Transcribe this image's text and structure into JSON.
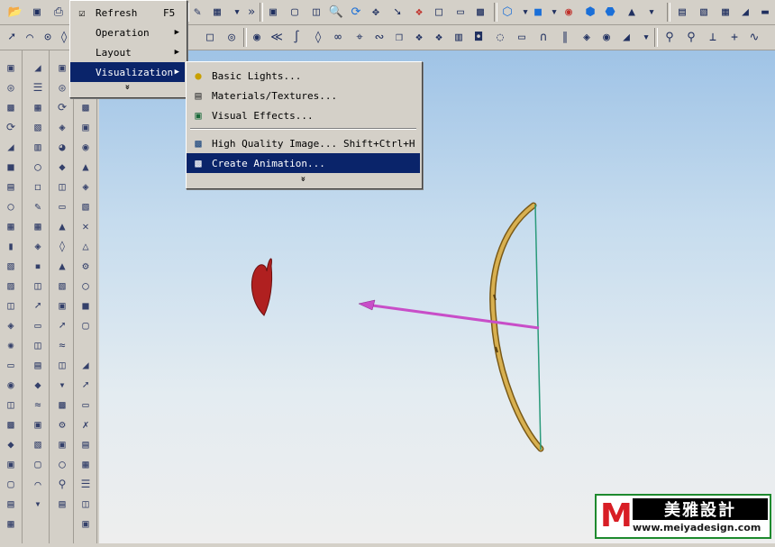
{
  "menus": {
    "main": {
      "items": [
        {
          "label": "Refresh",
          "accel": "F5"
        },
        {
          "label": "Operation"
        },
        {
          "label": "Layout"
        },
        {
          "label": "Visualization"
        }
      ]
    },
    "visualization": {
      "items": [
        {
          "label": "Basic Lights..."
        },
        {
          "label": "Materials/Textures..."
        },
        {
          "label": "Visual Effects..."
        },
        {
          "label": "High Quality Image...",
          "accel": "Shift+Ctrl+H"
        },
        {
          "label": "Create Animation..."
        }
      ]
    },
    "more_glyph": "»"
  },
  "toolbar": {
    "top_icons": [
      "folder-open-icon",
      "save-icon",
      "print-icon",
      "edit-icon",
      "fit-view-icon",
      "zoom-icon",
      "rotate-icon",
      "pan-icon",
      "refresh-icon",
      "shading-icon",
      "render-icon",
      "layer-icon"
    ],
    "second_icons": [
      "circle-icon",
      "point-icon",
      "line-icon",
      "arc-icon",
      "curve-icon",
      "spline-icon",
      "offset-icon",
      "trim-icon",
      "fillet-icon",
      "chamfer-icon"
    ]
  },
  "scene": {
    "arrow_color": "#c84ec8",
    "bow_color": "#c8a040",
    "string_color": "#2a9a7a",
    "heart_color": "#b02020"
  },
  "logo": {
    "mark": "M",
    "chinese": "美雅設計",
    "url": "www.meiyadesign.com"
  }
}
